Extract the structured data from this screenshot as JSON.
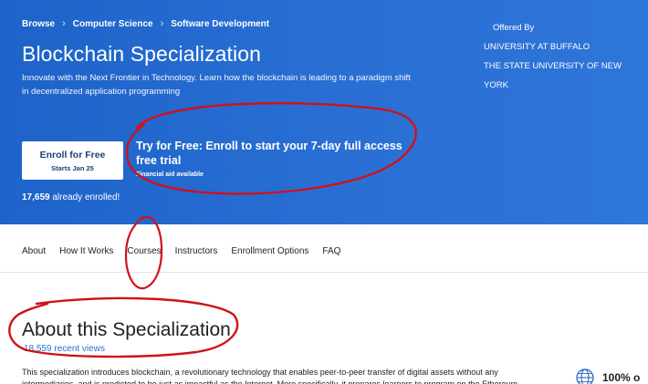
{
  "breadcrumb": {
    "items": [
      "Browse",
      "Computer Science",
      "Software Development"
    ],
    "sep": "›"
  },
  "hero": {
    "title": "Blockchain Specialization",
    "description": "Innovate with the Next Frontier in Technology. Learn how the blockchain is leading to a paradigm shift in decentralized application programming"
  },
  "offered_by": {
    "label": "Offered By",
    "orgs": [
      "UNIVERSITY AT BUFFALO",
      "THE STATE UNIVERSITY OF NEW YORK"
    ]
  },
  "enroll": {
    "label": "Enroll for Free",
    "start": "Starts Jan 25"
  },
  "trial": {
    "headline": "Try for Free: Enroll to start your 7-day full access free trial",
    "aid": "Financial aid available"
  },
  "enrolled": {
    "count": "17,659",
    "suffix": "already enrolled!"
  },
  "tabs": [
    "About",
    "How It Works",
    "Courses",
    "Instructors",
    "Enrollment Options",
    "FAQ"
  ],
  "about": {
    "title": "About this Specialization",
    "views": "18,559 recent views",
    "text": "This specialization introduces blockchain, a revolutionary technology that enables peer-to-peer transfer of digital assets without any intermediaries, and is predicted to be just as impactful as the Internet. More specifically, it prepares learners to program on the Ethereum"
  },
  "side_stat": {
    "icon": "globe-icon",
    "value": "100% o"
  },
  "colors": {
    "hero_bg": "#2a6fd4",
    "link_blue": "#2a73cc",
    "annotation_red": "#d0111b"
  }
}
